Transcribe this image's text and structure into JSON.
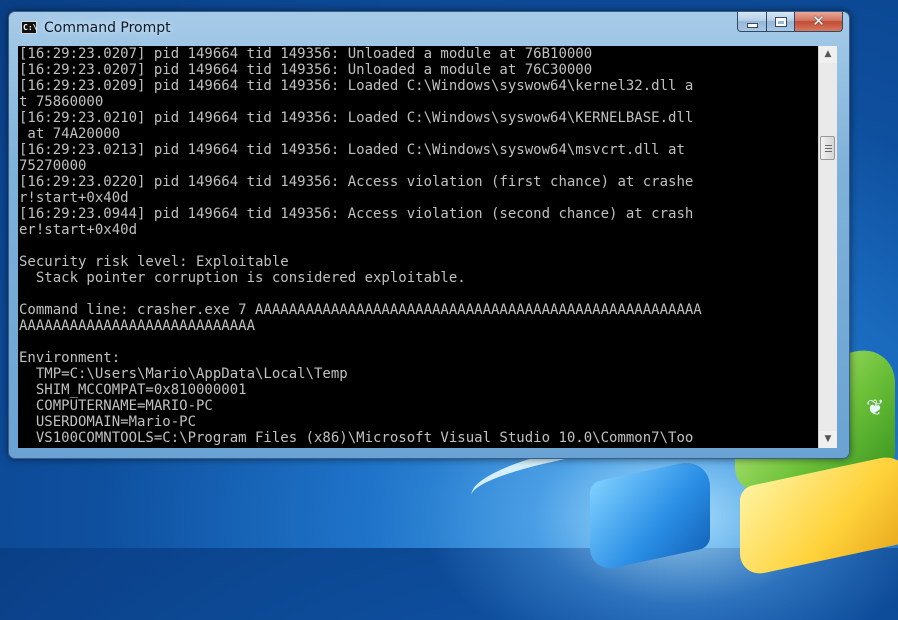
{
  "window": {
    "title": "Command Prompt",
    "icon": "cmd-icon"
  },
  "console": {
    "lines": [
      "[16:29:23.0207] pid 149664 tid 149356: Unloaded a module at 76B10000",
      "[16:29:23.0207] pid 149664 tid 149356: Unloaded a module at 76C30000",
      "[16:29:23.0209] pid 149664 tid 149356: Loaded C:\\Windows\\syswow64\\kernel32.dll a",
      "t 75860000",
      "[16:29:23.0210] pid 149664 tid 149356: Loaded C:\\Windows\\syswow64\\KERNELBASE.dll",
      " at 74A20000",
      "[16:29:23.0213] pid 149664 tid 149356: Loaded C:\\Windows\\syswow64\\msvcrt.dll at",
      "75270000",
      "[16:29:23.0220] pid 149664 tid 149356: Access violation (first chance) at crashe",
      "r!start+0x40d",
      "[16:29:23.0944] pid 149664 tid 149356: Access violation (second chance) at crash",
      "er!start+0x40d",
      "",
      "Security risk level: Exploitable",
      "  Stack pointer corruption is considered exploitable.",
      "",
      "Command line: crasher.exe 7 AAAAAAAAAAAAAAAAAAAAAAAAAAAAAAAAAAAAAAAAAAAAAAAAAAAAA",
      "AAAAAAAAAAAAAAAAAAAAAAAAAAAA",
      "",
      "Environment:",
      "  TMP=C:\\Users\\Mario\\AppData\\Local\\Temp",
      "  SHIM_MCCOMPAT=0x810000001",
      "  COMPUTERNAME=MARIO-PC",
      "  USERDOMAIN=Mario-PC",
      "  VS100COMNTOOLS=C:\\Program Files (x86)\\Microsoft Visual Studio 10.0\\Common7\\Too"
    ]
  },
  "caption_buttons": {
    "minimize": "minimize-icon",
    "maximize": "maximize-icon",
    "close": "✕"
  },
  "colors": {
    "console_bg": "#000000",
    "console_text": "#c0c0c0"
  }
}
